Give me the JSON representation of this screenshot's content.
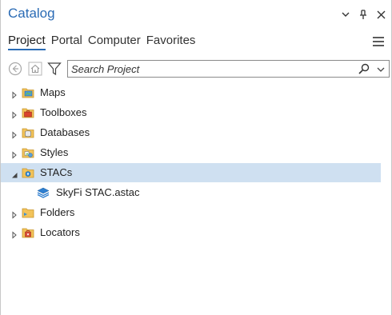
{
  "pane": {
    "title": "Catalog",
    "title_icons": [
      "chevron-down-icon",
      "pin-icon",
      "close-icon"
    ]
  },
  "tabs": [
    {
      "label": "Project",
      "active": true
    },
    {
      "label": "Portal",
      "active": false
    },
    {
      "label": "Computer",
      "active": false
    },
    {
      "label": "Favorites",
      "active": false
    }
  ],
  "toolbar": {
    "back_icon": "back-arrow-icon",
    "home_icon": "home-icon",
    "filter_icon": "filter-icon",
    "search_placeholder": "Search Project",
    "search_icon": "search-icon",
    "dropdown_icon": "chevron-down-icon"
  },
  "tree": {
    "items": [
      {
        "label": "Maps",
        "expanded": false,
        "selected": false
      },
      {
        "label": "Toolboxes",
        "expanded": false,
        "selected": false
      },
      {
        "label": "Databases",
        "expanded": false,
        "selected": false
      },
      {
        "label": "Styles",
        "expanded": false,
        "selected": false
      },
      {
        "label": "STACs",
        "expanded": true,
        "selected": true,
        "children": [
          {
            "label": "SkyFi STAC.astac"
          }
        ]
      },
      {
        "label": "Folders",
        "expanded": false,
        "selected": false
      },
      {
        "label": "Locators",
        "expanded": false,
        "selected": false
      }
    ]
  },
  "colors": {
    "accent": "#2a6bb5",
    "selection": "#cfe0f1",
    "folder": "#f2c35a"
  }
}
